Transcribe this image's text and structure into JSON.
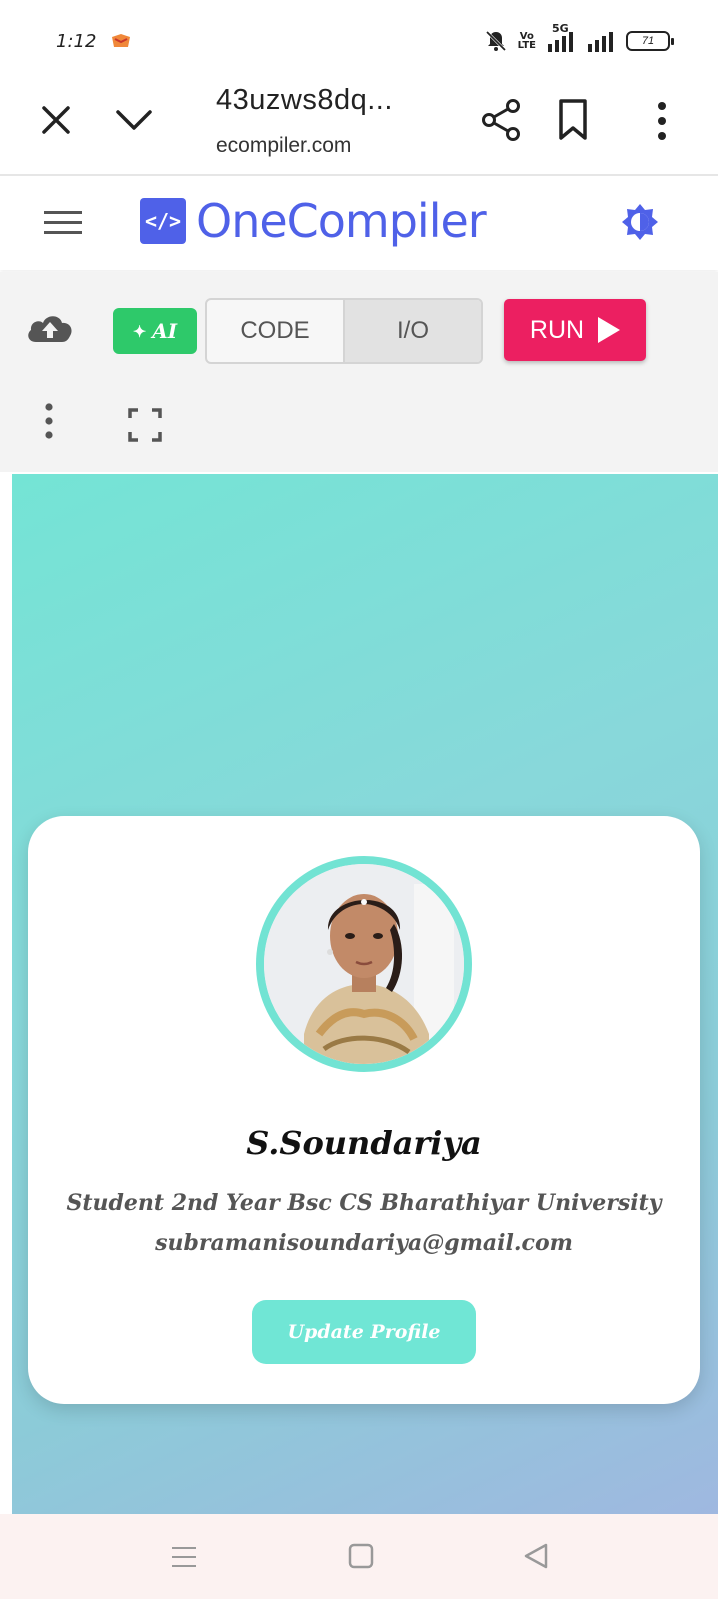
{
  "status_bar": {
    "time": "1:12",
    "volte_top": "Vo",
    "volte_bottom": "LTE",
    "network": "5G",
    "battery": "71"
  },
  "browser": {
    "page_title": "43uzws8dq...",
    "domain": "ecompiler.com"
  },
  "app": {
    "brand_logo": "</>",
    "brand_name": "OneCompiler",
    "accent_color": "#4f61e8"
  },
  "toolbar": {
    "ai_label": "AI",
    "tabs": [
      {
        "label": "CODE",
        "active": false
      },
      {
        "label": "I/O",
        "active": true
      }
    ],
    "run_label": "RUN",
    "run_color": "#ec1f61",
    "ai_color": "#2ec96a"
  },
  "profile_card": {
    "name": "S.Soundariya",
    "role": "Student 2nd Year Bsc CS Bharathiyar University",
    "email": "subramanisoundariya@gmail.com",
    "button_label": "Update Profile",
    "accent_color": "#70e6d5"
  }
}
